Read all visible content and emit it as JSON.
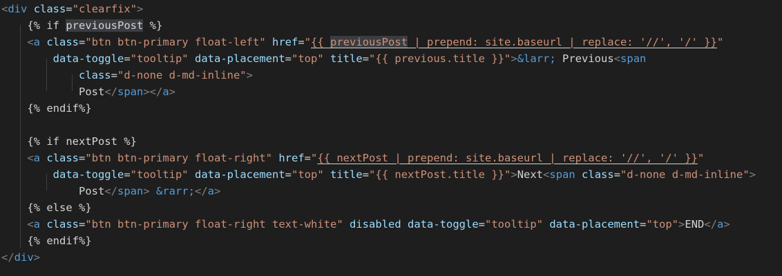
{
  "editor": {
    "lines": [
      [
        {
          "c": "t-bracket",
          "t": "<"
        },
        {
          "c": "t-tag",
          "t": "div"
        },
        {
          "c": "t-text",
          "t": " "
        },
        {
          "c": "t-attr",
          "t": "class"
        },
        {
          "c": "t-text",
          "t": "="
        },
        {
          "c": "t-str",
          "t": "\"clearfix\""
        },
        {
          "c": "t-bracket",
          "t": ">"
        }
      ],
      [
        {
          "c": "t-text",
          "t": "    {% if "
        },
        {
          "c": "t-text sel",
          "t": "previousPost"
        },
        {
          "c": "t-text",
          "t": " %}"
        }
      ],
      [
        {
          "c": "t-text",
          "t": "    "
        },
        {
          "c": "t-bracket",
          "t": "<"
        },
        {
          "c": "t-tag",
          "t": "a"
        },
        {
          "c": "t-text",
          "t": " "
        },
        {
          "c": "t-attr",
          "t": "class"
        },
        {
          "c": "t-text",
          "t": "="
        },
        {
          "c": "t-str",
          "t": "\"btn btn-primary float-left\""
        },
        {
          "c": "t-text",
          "t": " "
        },
        {
          "c": "t-attr",
          "t": "href"
        },
        {
          "c": "t-text",
          "t": "="
        },
        {
          "c": "t-str",
          "t": "\""
        },
        {
          "c": "t-str under",
          "t": "{{ "
        },
        {
          "c": "t-str under sel",
          "t": "previousPost"
        },
        {
          "c": "t-str under",
          "t": " | prepend: site.baseurl | replace: '//', '/' }}"
        },
        {
          "c": "t-str",
          "t": "\""
        }
      ],
      [
        {
          "c": "t-text",
          "t": "        "
        },
        {
          "c": "t-attr",
          "t": "data-toggle"
        },
        {
          "c": "t-text",
          "t": "="
        },
        {
          "c": "t-str",
          "t": "\"tooltip\""
        },
        {
          "c": "t-text",
          "t": " "
        },
        {
          "c": "t-attr",
          "t": "data-placement"
        },
        {
          "c": "t-text",
          "t": "="
        },
        {
          "c": "t-str",
          "t": "\"top\""
        },
        {
          "c": "t-text",
          "t": " "
        },
        {
          "c": "t-attr",
          "t": "title"
        },
        {
          "c": "t-text",
          "t": "="
        },
        {
          "c": "t-str",
          "t": "\"{{ previous.title }}\""
        },
        {
          "c": "t-bracket",
          "t": ">"
        },
        {
          "c": "t-tag",
          "t": "&larr;"
        },
        {
          "c": "t-text",
          "t": " Previous"
        },
        {
          "c": "t-bracket",
          "t": "<"
        },
        {
          "c": "t-tag",
          "t": "span"
        }
      ],
      [
        {
          "c": "t-text",
          "t": "            "
        },
        {
          "c": "t-attr",
          "t": "class"
        },
        {
          "c": "t-text",
          "t": "="
        },
        {
          "c": "t-str",
          "t": "\"d-none d-md-inline\""
        },
        {
          "c": "t-bracket",
          "t": ">"
        }
      ],
      [
        {
          "c": "t-text",
          "t": "            Post"
        },
        {
          "c": "t-bracket",
          "t": "</"
        },
        {
          "c": "t-tag",
          "t": "span"
        },
        {
          "c": "t-bracket",
          "t": "></"
        },
        {
          "c": "t-tag",
          "t": "a"
        },
        {
          "c": "t-bracket",
          "t": ">"
        }
      ],
      [
        {
          "c": "t-text",
          "t": "    {% endif%}"
        }
      ],
      [
        {
          "c": "t-text",
          "t": ""
        }
      ],
      [
        {
          "c": "t-text",
          "t": "    {% if nextPost %}"
        }
      ],
      [
        {
          "c": "t-text",
          "t": "    "
        },
        {
          "c": "t-bracket",
          "t": "<"
        },
        {
          "c": "t-tag",
          "t": "a"
        },
        {
          "c": "t-text",
          "t": " "
        },
        {
          "c": "t-attr",
          "t": "class"
        },
        {
          "c": "t-text",
          "t": "="
        },
        {
          "c": "t-str",
          "t": "\"btn btn-primary float-right\""
        },
        {
          "c": "t-text",
          "t": " "
        },
        {
          "c": "t-attr",
          "t": "href"
        },
        {
          "c": "t-text",
          "t": "="
        },
        {
          "c": "t-str",
          "t": "\""
        },
        {
          "c": "t-str under",
          "t": "{{ nextPost | prepend: site.baseurl | replace: '//', '/' }}"
        },
        {
          "c": "t-str",
          "t": "\""
        }
      ],
      [
        {
          "c": "t-text",
          "t": "        "
        },
        {
          "c": "t-attr",
          "t": "data-toggle"
        },
        {
          "c": "t-text",
          "t": "="
        },
        {
          "c": "t-str",
          "t": "\"tooltip\""
        },
        {
          "c": "t-text",
          "t": " "
        },
        {
          "c": "t-attr",
          "t": "data-placement"
        },
        {
          "c": "t-text",
          "t": "="
        },
        {
          "c": "t-str",
          "t": "\"top\""
        },
        {
          "c": "t-text",
          "t": " "
        },
        {
          "c": "t-attr",
          "t": "title"
        },
        {
          "c": "t-text",
          "t": "="
        },
        {
          "c": "t-str",
          "t": "\"{{ nextPost.title }}\""
        },
        {
          "c": "t-bracket",
          "t": ">"
        },
        {
          "c": "t-text",
          "t": "Next"
        },
        {
          "c": "t-bracket",
          "t": "<"
        },
        {
          "c": "t-tag",
          "t": "span"
        },
        {
          "c": "t-text",
          "t": " "
        },
        {
          "c": "t-attr",
          "t": "class"
        },
        {
          "c": "t-text",
          "t": "="
        },
        {
          "c": "t-str",
          "t": "\"d-none d-md-inline\""
        },
        {
          "c": "t-bracket",
          "t": ">"
        }
      ],
      [
        {
          "c": "t-text",
          "t": "            Post"
        },
        {
          "c": "t-bracket",
          "t": "</"
        },
        {
          "c": "t-tag",
          "t": "span"
        },
        {
          "c": "t-bracket",
          "t": ">"
        },
        {
          "c": "t-text",
          "t": " "
        },
        {
          "c": "t-tag",
          "t": "&rarr;"
        },
        {
          "c": "t-bracket",
          "t": "</"
        },
        {
          "c": "t-tag",
          "t": "a"
        },
        {
          "c": "t-bracket",
          "t": ">"
        }
      ],
      [
        {
          "c": "t-text",
          "t": "    {% else %}"
        }
      ],
      [
        {
          "c": "t-text",
          "t": "    "
        },
        {
          "c": "t-bracket",
          "t": "<"
        },
        {
          "c": "t-tag",
          "t": "a"
        },
        {
          "c": "t-text",
          "t": " "
        },
        {
          "c": "t-attr",
          "t": "class"
        },
        {
          "c": "t-text",
          "t": "="
        },
        {
          "c": "t-str",
          "t": "\"btn btn-primary float-right text-white\""
        },
        {
          "c": "t-text",
          "t": " "
        },
        {
          "c": "t-attr",
          "t": "disabled"
        },
        {
          "c": "t-text",
          "t": " "
        },
        {
          "c": "t-attr",
          "t": "data-toggle"
        },
        {
          "c": "t-text",
          "t": "="
        },
        {
          "c": "t-str",
          "t": "\"tooltip\""
        },
        {
          "c": "t-text",
          "t": " "
        },
        {
          "c": "t-attr",
          "t": "data-placement"
        },
        {
          "c": "t-text",
          "t": "="
        },
        {
          "c": "t-str",
          "t": "\"top\""
        },
        {
          "c": "t-bracket",
          "t": ">"
        },
        {
          "c": "t-text",
          "t": "END"
        },
        {
          "c": "t-bracket",
          "t": "</"
        },
        {
          "c": "t-tag",
          "t": "a"
        },
        {
          "c": "t-bracket",
          "t": ">"
        }
      ],
      [
        {
          "c": "t-text",
          "t": "    {% endif%}"
        }
      ],
      [
        {
          "c": "t-bracket",
          "t": "</"
        },
        {
          "c": "t-tag",
          "t": "div"
        },
        {
          "c": "t-bracket",
          "t": ">"
        }
      ]
    ],
    "colors": {
      "background": "#1e1e1e",
      "tag": "#569cd6",
      "bracket": "#808080",
      "attribute": "#9cdcfe",
      "string": "#ce9178",
      "text": "#d4d4d4",
      "selection_highlight": "#3a3d41"
    }
  }
}
